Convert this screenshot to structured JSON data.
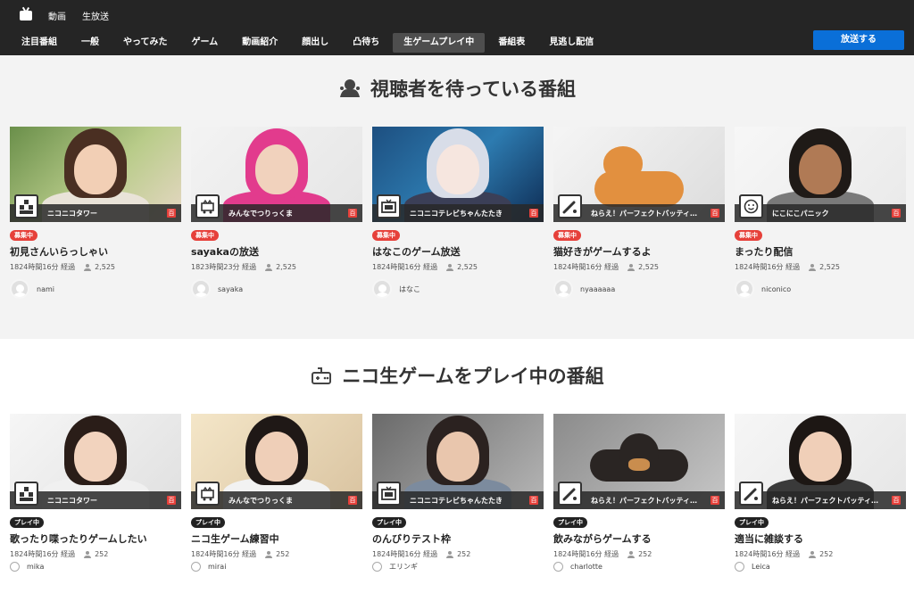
{
  "header": {
    "top_links": [
      "動画",
      "生放送"
    ],
    "nav": [
      {
        "label": "注目番組",
        "active": false
      },
      {
        "label": "一般",
        "active": false
      },
      {
        "label": "やってみた",
        "active": false
      },
      {
        "label": "ゲーム",
        "active": false
      },
      {
        "label": "動画紹介",
        "active": false
      },
      {
        "label": "顔出し",
        "active": false
      },
      {
        "label": "凸待ち",
        "active": false
      },
      {
        "label": "生ゲームプレイ中",
        "active": true
      },
      {
        "label": "番組表",
        "active": false
      },
      {
        "label": "見逃し配信",
        "active": false
      }
    ],
    "broadcast_button": "放送する",
    "accent_color": "#0a6fd8"
  },
  "sections": [
    {
      "title": "視聴者を待っている番組",
      "icon": "waiting-person-icon",
      "cards": [
        {
          "channel": "ニコニコタワー",
          "channel_icon": "tower-icon",
          "status": "募集中",
          "title": "初見さんいらっしゃい",
          "elapsed": "1824時間16分 経過",
          "viewers": "2,525",
          "user": "nami"
        },
        {
          "channel": "みんなでつりっくま",
          "channel_icon": "bear-cart-icon",
          "status": "募集中",
          "title": "sayakaの放送",
          "elapsed": "1823時間23分 経過",
          "viewers": "2,525",
          "user": "sayaka"
        },
        {
          "channel": "ニコニコテレビちゃんたたき",
          "channel_icon": "tv-icon",
          "status": "募集中",
          "title": "はなこのゲーム放送",
          "elapsed": "1824時間16分 経過",
          "viewers": "2,525",
          "user": "はなこ"
        },
        {
          "channel": "ねらえ！パーフェクトバッティ…",
          "channel_icon": "bat-icon",
          "status": "募集中",
          "title": "猫好きがゲームするよ",
          "elapsed": "1824時間16分 経過",
          "viewers": "2,525",
          "user": "nyaaaaaa"
        },
        {
          "channel": "にこにこパニック",
          "channel_icon": "smile-icon",
          "status": "募集中",
          "title": "まったり配信",
          "elapsed": "1824時間16分 経過",
          "viewers": "2,525",
          "user": "niconico"
        }
      ]
    },
    {
      "title": "ニコ生ゲームをプレイ中の番組",
      "icon": "game-controller-icon",
      "cards": [
        {
          "channel": "ニコニコタワー",
          "channel_icon": "tower-icon",
          "status": "プレイ中",
          "title": "歌ったり喋ったりゲームしたい",
          "elapsed": "1824時間16分 経過",
          "viewers": "252",
          "user": "mika"
        },
        {
          "channel": "みんなでつりっくま",
          "channel_icon": "bear-cart-icon",
          "status": "プレイ中",
          "title": "ニコ生ゲーム練習中",
          "elapsed": "1824時間16分 経過",
          "viewers": "252",
          "user": "mirai"
        },
        {
          "channel": "ニコニコテレビちゃんたたき",
          "channel_icon": "tv-icon",
          "status": "プレイ中",
          "title": "のんびりテスト枠",
          "elapsed": "1824時間16分 経過",
          "viewers": "252",
          "user": "エリンギ"
        },
        {
          "channel": "ねらえ！パーフェクトバッティング",
          "channel_icon": "bat-icon",
          "status": "プレイ中",
          "title": "飲みながらゲームする",
          "elapsed": "1824時間16分 経過",
          "viewers": "252",
          "user": "charlotte"
        },
        {
          "channel": "ねらえ！パーフェクトバッティング",
          "channel_icon": "bat-icon",
          "status": "プレイ中",
          "title": "適当に雑談する",
          "elapsed": "1824時間16分 経過",
          "viewers": "252",
          "user": "Leica"
        }
      ]
    }
  ],
  "channel_badge": "百"
}
